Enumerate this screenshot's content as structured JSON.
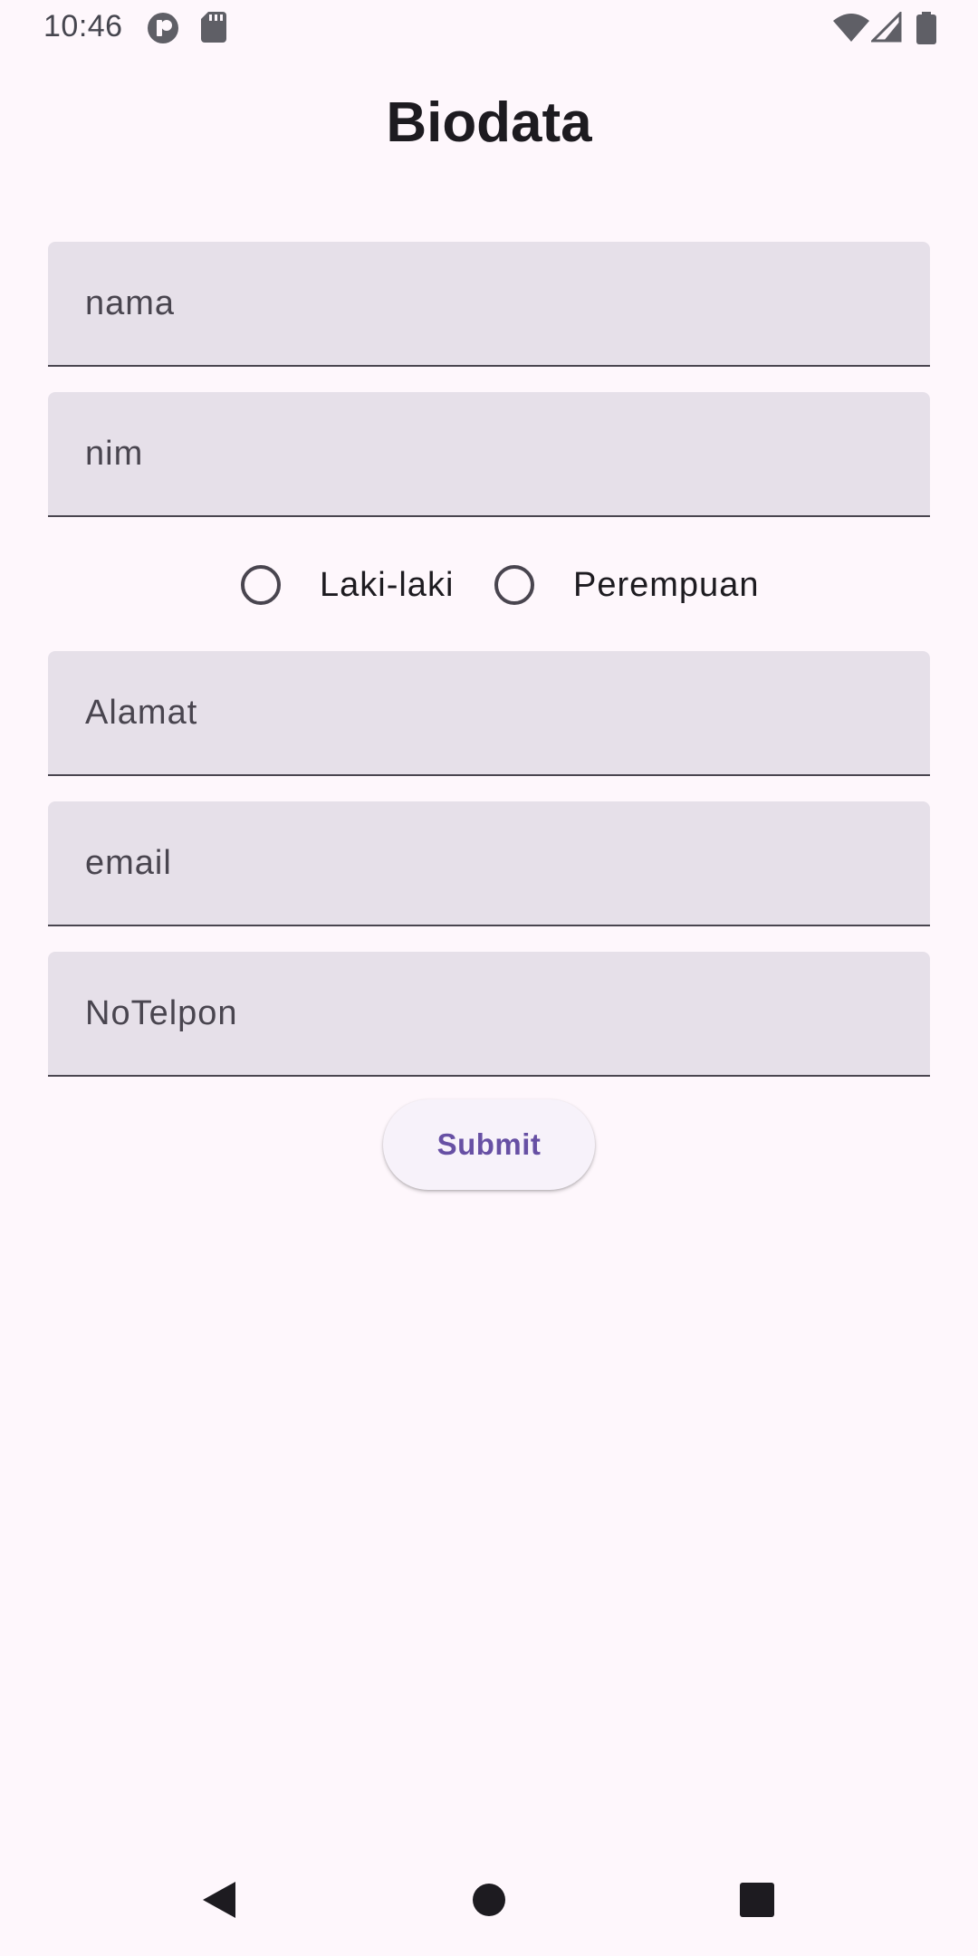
{
  "status_bar": {
    "time": "10:46",
    "icons": [
      "app-notification-icon",
      "sd-card-icon",
      "wifi-icon",
      "cellular-signal-icon",
      "battery-icon"
    ]
  },
  "page": {
    "title": "Biodata"
  },
  "form": {
    "nama": {
      "placeholder": "nama",
      "value": ""
    },
    "nim": {
      "placeholder": "nim",
      "value": ""
    },
    "gender": {
      "options": [
        {
          "label": "Laki-laki",
          "selected": false
        },
        {
          "label": "Perempuan",
          "selected": false
        }
      ]
    },
    "alamat": {
      "placeholder": "Alamat",
      "value": ""
    },
    "email": {
      "placeholder": "email",
      "value": ""
    },
    "notelpon": {
      "placeholder": "NoTelpon",
      "value": ""
    },
    "submit_label": "Submit"
  },
  "nav_bar": {
    "icons": [
      "back-icon",
      "home-icon",
      "recents-icon"
    ]
  },
  "colors": {
    "background": "#fef7fc",
    "field_fill": "#e6e0e9",
    "field_underline": "#49454f",
    "button_text": "#6750a4",
    "button_fill": "#f7f2fa"
  }
}
